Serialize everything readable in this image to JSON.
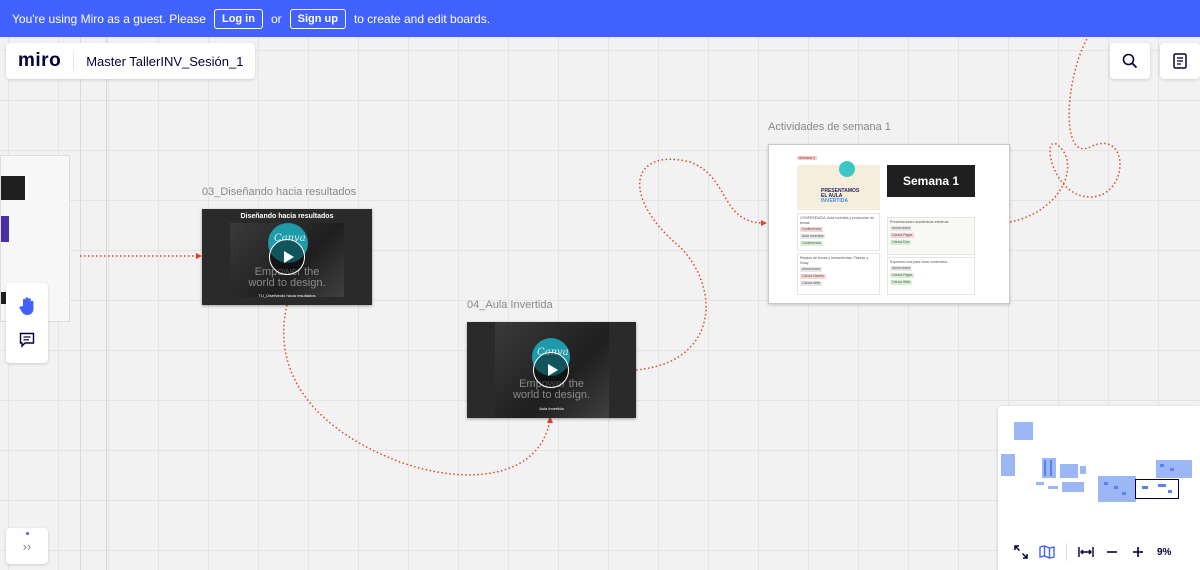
{
  "banner": {
    "text_before": "You're using Miro as a guest. Please",
    "login_label": "Log in",
    "or_text": "or",
    "signup_label": "Sign up",
    "text_after": "to create and edit boards.",
    "color": "#4262ff"
  },
  "header": {
    "logo": "miro",
    "board_title": "Master TallerINV_Sesión_1"
  },
  "toolbar_icons": [
    "search-icon",
    "notes-icon"
  ],
  "left_tools": [
    "hand-icon",
    "comment-icon"
  ],
  "expand_label": "››",
  "frames": {
    "video1": {
      "label": "03_Diseñando hacia resultados",
      "title": "Diseñando hacia resultados",
      "canva": "Canva",
      "empower_line1": "Empower the",
      "empower_line2": "world to design.",
      "caption": "TU_Diseñando hacia resultados"
    },
    "video2": {
      "label": "04_Aula Invertida",
      "canva": "Canva",
      "empower_line1": "Empower the",
      "empower_line2": "world to design.",
      "caption": "Aula Invertida"
    },
    "semana": {
      "label": "Actividades de semana 1",
      "title": "Semana 1",
      "tag": "Semana 1",
      "poster_line1": "PRESENTAMOS",
      "poster_line2": "EL AULA",
      "poster_line3": "INVERTIDA",
      "cards": [
        {
          "title": "CONFERENCIA: Aula invertida y producción de temas",
          "tags": [
            "Conferencia",
            "Aula Invertida",
            "Conferencia"
          ]
        },
        {
          "title": "Presentaciones académicas efectivas",
          "tags": [
            "Asincrónica",
            "Canva Pager",
            "Canva Doc"
          ]
        },
        {
          "title": "Repaso de temas y herramientas, Planner y Sway",
          "tags": [
            "Asincrónica",
            "Canva Diseño",
            "Canva Web"
          ]
        },
        {
          "title": "Expresión oral para crear contenidos",
          "tags": [
            "Asincrónica",
            "Canva Pager",
            "Canva Web"
          ]
        }
      ]
    }
  },
  "zoom": {
    "level": "9%",
    "icons": [
      "fullscreen-icon",
      "map-icon",
      "fit-width-icon",
      "zoom-out-icon",
      "zoom-in-icon"
    ]
  }
}
